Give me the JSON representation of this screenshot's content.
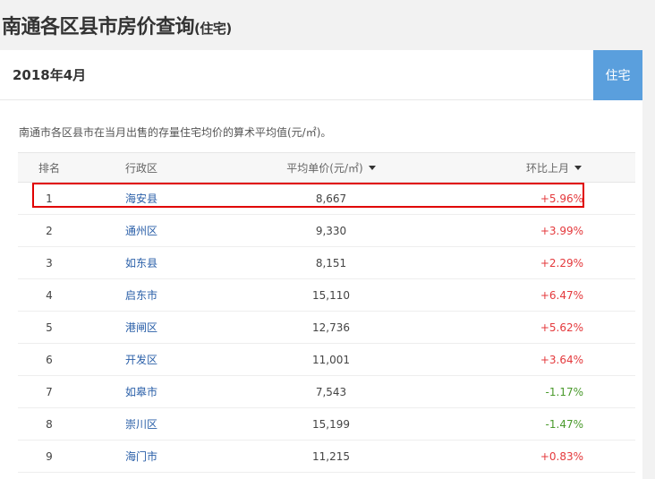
{
  "page": {
    "title": "南通各区县市房价查询",
    "title_suffix": "(住宅)"
  },
  "card": {
    "period": "2018年4月",
    "type_tab": "住宅",
    "description": "南通市各区县市在当月出售的存量住宅均价的算术平均值(元/㎡)。"
  },
  "table": {
    "headers": {
      "rank": "排名",
      "district": "行政区",
      "price": "平均单价(元/㎡)",
      "change": "环比上月"
    },
    "rows": [
      {
        "rank": "1",
        "district": "海安县",
        "price": "8,667",
        "change": "+5.96%",
        "trend": "pos"
      },
      {
        "rank": "2",
        "district": "通州区",
        "price": "9,330",
        "change": "+3.99%",
        "trend": "pos"
      },
      {
        "rank": "3",
        "district": "如东县",
        "price": "8,151",
        "change": "+2.29%",
        "trend": "pos"
      },
      {
        "rank": "4",
        "district": "启东市",
        "price": "15,110",
        "change": "+6.47%",
        "trend": "pos"
      },
      {
        "rank": "5",
        "district": "港闸区",
        "price": "12,736",
        "change": "+5.62%",
        "trend": "pos"
      },
      {
        "rank": "6",
        "district": "开发区",
        "price": "11,001",
        "change": "+3.64%",
        "trend": "pos"
      },
      {
        "rank": "7",
        "district": "如皋市",
        "price": "7,543",
        "change": "-1.17%",
        "trend": "neg"
      },
      {
        "rank": "8",
        "district": "崇川区",
        "price": "15,199",
        "change": "-1.47%",
        "trend": "neg"
      },
      {
        "rank": "9",
        "district": "海门市",
        "price": "11,215",
        "change": "+0.83%",
        "trend": "pos"
      }
    ]
  },
  "colors": {
    "accent_tab": "#5a9fdd",
    "positive": "#e4393c",
    "negative": "#4a9a2c",
    "highlight_border": "#e00000"
  },
  "highlight": {
    "row_rank": "1"
  }
}
